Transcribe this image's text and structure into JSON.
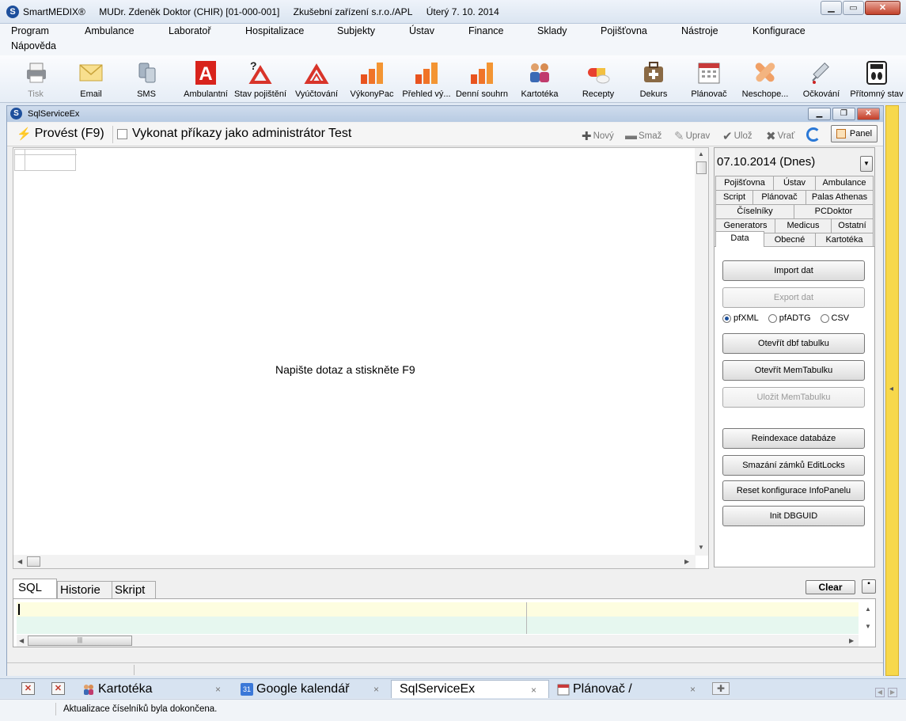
{
  "titlebar": {
    "app_name": "SmartMEDIX®",
    "doctor": "MUDr. Zdeněk Doktor (CHIR) [01-000-001]",
    "facility": "Zkušební zařízení s.r.o./APL",
    "date": "Úterý 7. 10. 2014",
    "logo_letter": "S"
  },
  "menu": [
    "Program",
    "Ambulance",
    "Laboratoř",
    "Hospitalizace",
    "Subjekty",
    "Ústav",
    "Finance",
    "Sklady",
    "Pojišťovna",
    "Nástroje",
    "Konfigurace",
    "Nápověda"
  ],
  "toolbar": [
    {
      "label": "Tisk",
      "icon": "printer-icon",
      "disabled": true
    },
    {
      "label": "Email",
      "icon": "envelope-icon"
    },
    {
      "label": "SMS",
      "icon": "phone-icon"
    },
    {
      "label": "Ambulantní",
      "icon": "ambulance-a-icon"
    },
    {
      "label": "Stav pojištění",
      "icon": "insurance-status-icon"
    },
    {
      "label": "Vyúčtování",
      "icon": "billing-icon"
    },
    {
      "label": "VýkonyPac",
      "icon": "bar-chart-icon"
    },
    {
      "label": "Přehled vý...",
      "icon": "bar-chart-icon"
    },
    {
      "label": "Denní souhrn",
      "icon": "bar-chart-icon"
    },
    {
      "label": "Kartotéka",
      "icon": "patients-icon"
    },
    {
      "label": "Recepty",
      "icon": "pills-icon"
    },
    {
      "label": "Dekurs",
      "icon": "medical-bag-icon"
    },
    {
      "label": "Plánovač",
      "icon": "calendar-icon"
    },
    {
      "label": "Neschope...",
      "icon": "bandage-icon"
    },
    {
      "label": "Očkování",
      "icon": "syringe-icon"
    },
    {
      "label": "Přítomný stav",
      "icon": "scale-icon"
    }
  ],
  "inner_window": {
    "title": "SqlServiceEx",
    "run_label": "Provést (F9)",
    "admin_label": "Vykonat příkazy jako administrátor",
    "test_label": "Test",
    "actions": {
      "new": "Nový",
      "delete": "Smaž",
      "edit": "Uprav",
      "save": "Ulož",
      "revert": "Vrať"
    },
    "panel_label": "Panel",
    "grid_hint": "Napište dotaz a stiskněte F9"
  },
  "right_panel": {
    "date": "07.10.2014 (Dnes)",
    "tabs_row1": [
      "Pojišťovna",
      "Ústav",
      "Ambulance"
    ],
    "tabs_row2": [
      "Script",
      "Plánovač",
      "Palas Athenas"
    ],
    "tabs_row3": [
      "Číselníky",
      "PCDoktor"
    ],
    "tabs_row4": [
      "Generators",
      "Medicus",
      "Ostatní"
    ],
    "tabs_row5": [
      "Data",
      "Obecné",
      "Kartotéka"
    ],
    "buttons": {
      "import": "Import dat",
      "export": "Export dat",
      "open_dbf": "Otevřít dbf tabulku",
      "open_mem": "Otevřít MemTabulku",
      "save_mem": "Uložit MemTabulku",
      "reindex": "Reindexace databáze",
      "delete_locks": "Smazání zámků EditLocks",
      "reset_info": "Reset konfigurace InfoPanelu",
      "init_guid": "Init DBGUID"
    },
    "radios": [
      "pfXML",
      "pfADTG",
      "CSV"
    ],
    "radio_selected": "pfXML"
  },
  "sql_tabs": [
    "SQL",
    "Historie",
    "Skript"
  ],
  "clear_label": "Clear",
  "window_tabs": [
    {
      "label": "Kartotéka",
      "icon": "patients-icon"
    },
    {
      "label": "Google kalendář",
      "icon": "google-calendar-icon"
    },
    {
      "label": "SqlServiceEx",
      "active": true
    },
    {
      "label": "Plánovač /",
      "icon": "calendar-icon"
    }
  ],
  "status_text": "Aktualizace číselníků byla dokončena.",
  "close_glyph": "×"
}
